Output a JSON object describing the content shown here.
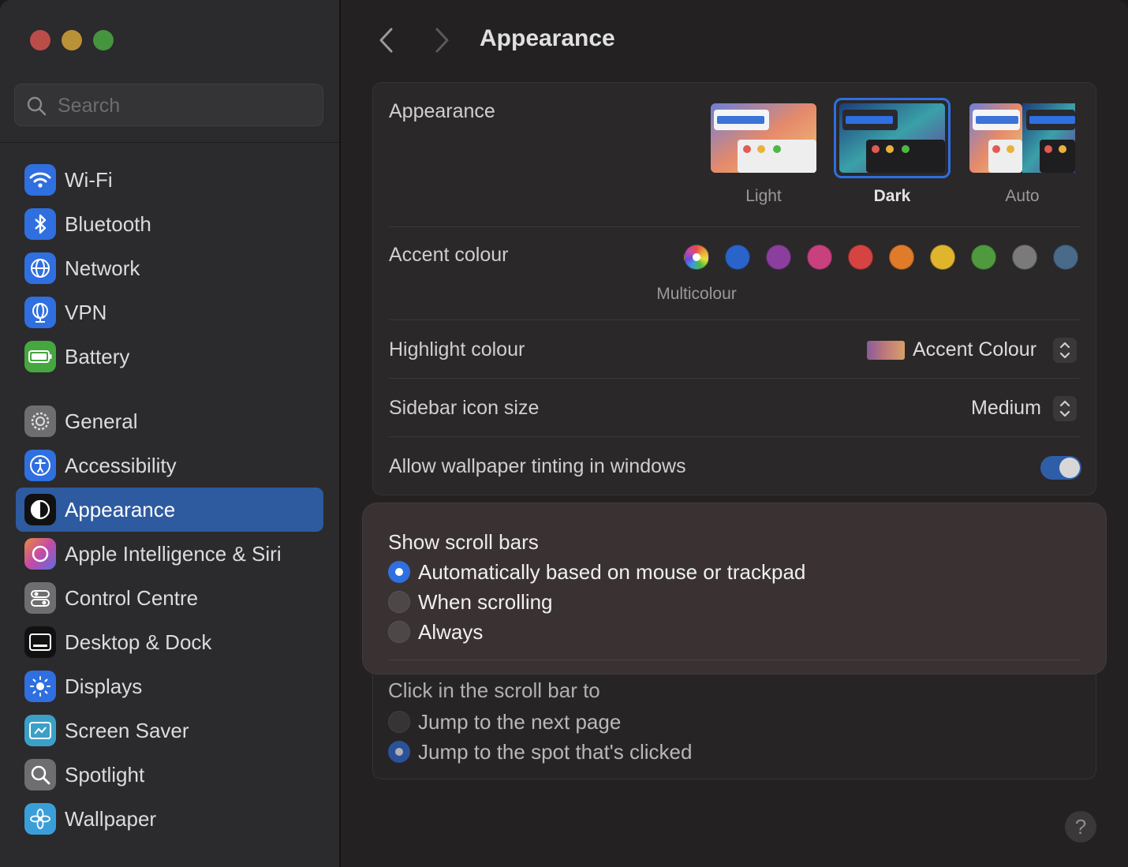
{
  "search": {
    "placeholder": "Search"
  },
  "sidebar": {
    "items": [
      {
        "label": "Wi-Fi",
        "icon": "wifi-icon",
        "color": "#2f6fe0"
      },
      {
        "label": "Bluetooth",
        "icon": "bluetooth-icon",
        "color": "#2f6fe0"
      },
      {
        "label": "Network",
        "icon": "globe-icon",
        "color": "#2f6fe0"
      },
      {
        "label": "VPN",
        "icon": "vpn-icon",
        "color": "#2f6fe0"
      },
      {
        "label": "Battery",
        "icon": "battery-icon",
        "color": "#46a640"
      },
      {
        "label": "General",
        "icon": "gear-icon",
        "color": "#6e6e70"
      },
      {
        "label": "Accessibility",
        "icon": "accessibility-icon",
        "color": "#2f6fe0"
      },
      {
        "label": "Appearance",
        "icon": "appearance-icon",
        "color": "#111111",
        "active": true
      },
      {
        "label": "Apple Intelligence & Siri",
        "icon": "siri-icon",
        "color": "#b25fd0"
      },
      {
        "label": "Control Centre",
        "icon": "control-centre-icon",
        "color": "#6e6e70"
      },
      {
        "label": "Desktop & Dock",
        "icon": "desktop-dock-icon",
        "color": "#111111"
      },
      {
        "label": "Displays",
        "icon": "displays-icon",
        "color": "#2f6fe0"
      },
      {
        "label": "Screen Saver",
        "icon": "screen-saver-icon",
        "color": "#3aa0c8"
      },
      {
        "label": "Spotlight",
        "icon": "spotlight-icon",
        "color": "#6e6e70"
      },
      {
        "label": "Wallpaper",
        "icon": "wallpaper-icon",
        "color": "#3a9fd8"
      }
    ]
  },
  "header": {
    "title": "Appearance"
  },
  "appearance": {
    "label": "Appearance",
    "options": [
      {
        "label": "Light",
        "selected": false
      },
      {
        "label": "Dark",
        "selected": true
      },
      {
        "label": "Auto",
        "selected": false
      }
    ]
  },
  "accent": {
    "label": "Accent colour",
    "selected_caption": "Multicolour",
    "colors": [
      "multicolour",
      "#2a63c9",
      "#8a3f9e",
      "#c8407e",
      "#d54343",
      "#e07b2a",
      "#e0b52e",
      "#4f9a3f",
      "#7a7a7a",
      "#4a6a8a"
    ]
  },
  "highlight": {
    "label": "Highlight colour",
    "value": "Accent Colour"
  },
  "sidebar_icon_size": {
    "label": "Sidebar icon size",
    "value": "Medium"
  },
  "wallpaper_tinting": {
    "label": "Allow wallpaper tinting in windows",
    "enabled": true
  },
  "scroll_bars": {
    "label": "Show scroll bars",
    "options": [
      {
        "label": "Automatically based on mouse or trackpad",
        "selected": true
      },
      {
        "label": "When scrolling",
        "selected": false
      },
      {
        "label": "Always",
        "selected": false
      }
    ]
  },
  "click_scroll": {
    "label": "Click in the scroll bar to",
    "options": [
      {
        "label": "Jump to the next page",
        "selected": false
      },
      {
        "label": "Jump to the spot that's clicked",
        "selected": true
      }
    ]
  },
  "help": {
    "label": "?"
  }
}
